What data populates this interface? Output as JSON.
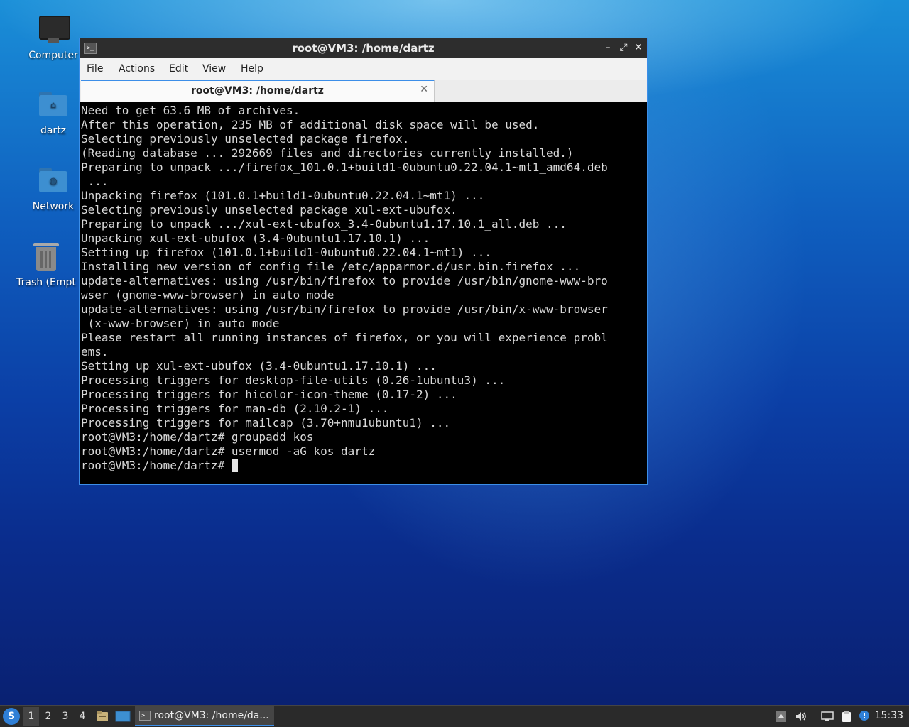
{
  "desktop": {
    "icons": [
      {
        "label": "Computer",
        "icon": "computer-icon"
      },
      {
        "label": "dartz",
        "icon": "home-folder-icon"
      },
      {
        "label": "Network",
        "icon": "network-folder-icon"
      },
      {
        "label": "Trash (Empt",
        "icon": "trash-icon"
      }
    ]
  },
  "window": {
    "title": "root@VM3: /home/dartz",
    "app_icon_glyph": ">_",
    "controls": {
      "minimize": "–",
      "maximize": "⤢",
      "close": "✕"
    },
    "menu": [
      "File",
      "Actions",
      "Edit",
      "View",
      "Help"
    ],
    "tab": {
      "title": "root@VM3: /home/dartz",
      "close": "✕"
    },
    "terminal_lines": [
      "Need to get 63.6 MB of archives.",
      "After this operation, 235 MB of additional disk space will be used.",
      "Selecting previously unselected package firefox.",
      "(Reading database ... 292669 files and directories currently installed.)",
      "Preparing to unpack .../firefox_101.0.1+build1-0ubuntu0.22.04.1~mt1_amd64.deb",
      " ...",
      "Unpacking firefox (101.0.1+build1-0ubuntu0.22.04.1~mt1) ...",
      "Selecting previously unselected package xul-ext-ubufox.",
      "Preparing to unpack .../xul-ext-ubufox_3.4-0ubuntu1.17.10.1_all.deb ...",
      "Unpacking xul-ext-ubufox (3.4-0ubuntu1.17.10.1) ...",
      "Setting up firefox (101.0.1+build1-0ubuntu0.22.04.1~mt1) ...",
      "Installing new version of config file /etc/apparmor.d/usr.bin.firefox ...",
      "update-alternatives: using /usr/bin/firefox to provide /usr/bin/gnome-www-bro",
      "wser (gnome-www-browser) in auto mode",
      "update-alternatives: using /usr/bin/firefox to provide /usr/bin/x-www-browser",
      " (x-www-browser) in auto mode",
      "Please restart all running instances of firefox, or you will experience probl",
      "ems.",
      "Setting up xul-ext-ubufox (3.4-0ubuntu1.17.10.1) ...",
      "Processing triggers for desktop-file-utils (0.26-1ubuntu3) ...",
      "Processing triggers for hicolor-icon-theme (0.17-2) ...",
      "Processing triggers for man-db (2.10.2-1) ...",
      "Processing triggers for mailcap (3.70+nmu1ubuntu1) ...",
      "root@VM3:/home/dartz# groupadd kos",
      "root@VM3:/home/dartz# usermod -aG kos dartz"
    ],
    "prompt": "root@VM3:/home/dartz# "
  },
  "taskbar": {
    "start_glyph": "S",
    "workspaces": [
      "1",
      "2",
      "3",
      "4"
    ],
    "active_workspace": "1",
    "task_label": "root@VM3: /home/da...",
    "task_icon_glyph": ">_",
    "clock": "15:33"
  }
}
